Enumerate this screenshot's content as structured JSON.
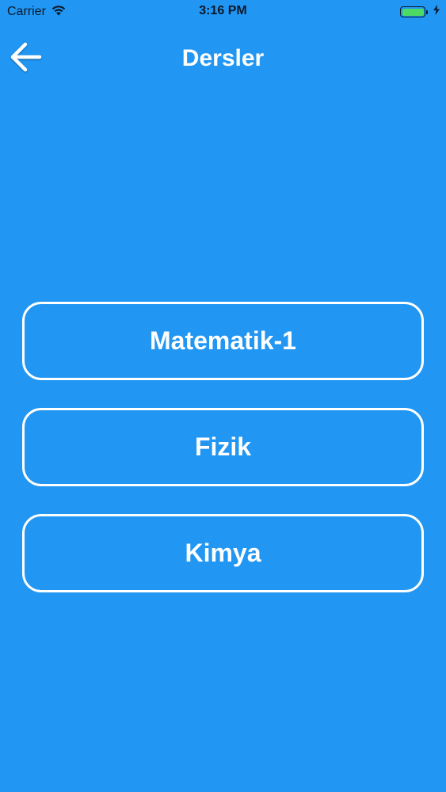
{
  "status_bar": {
    "carrier": "Carrier",
    "time": "3:16 PM",
    "wifi_icon": "wifi-icon",
    "battery_icon": "battery-icon",
    "charging_icon": "charging-bolt-icon",
    "battery_color": "#4cd964"
  },
  "app_bar": {
    "back_icon": "arrow-left-icon",
    "title": "Dersler"
  },
  "courses": [
    {
      "label": "Matematik-1"
    },
    {
      "label": "Fizik"
    },
    {
      "label": "Kimya"
    }
  ],
  "colors": {
    "background": "#2196F3",
    "foreground": "#ffffff"
  }
}
